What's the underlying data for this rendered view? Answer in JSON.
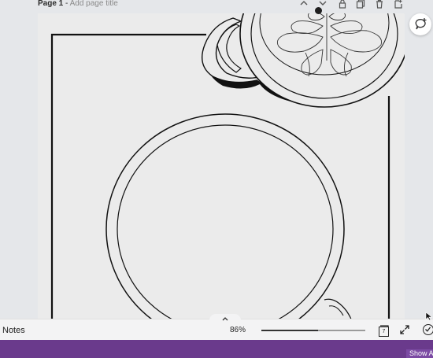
{
  "page_header": {
    "page_label": "Page 1",
    "separator": " - ",
    "title_placeholder": "Add page title",
    "icons": [
      "chevron-up-icon",
      "chevron-down-icon",
      "lock-icon",
      "duplicate-icon",
      "trash-icon",
      "add-page-icon"
    ]
  },
  "side_panel": {
    "icon": "comment-add-icon"
  },
  "bottom_bar": {
    "notes_label": "Notes",
    "collapse_icon": "chevron-up-icon",
    "zoom_label": "86%",
    "zoom_level_percent": 86,
    "pages_count": "7",
    "fullscreen_icon": "expand-icon",
    "check_icon": "check-circle-icon"
  },
  "taskbar": {
    "show_all_label": "Show A"
  },
  "colors": {
    "accent_purple": "#6a3a8c",
    "canvas": "#ebebeb",
    "workspace": "#e5e7ea"
  }
}
